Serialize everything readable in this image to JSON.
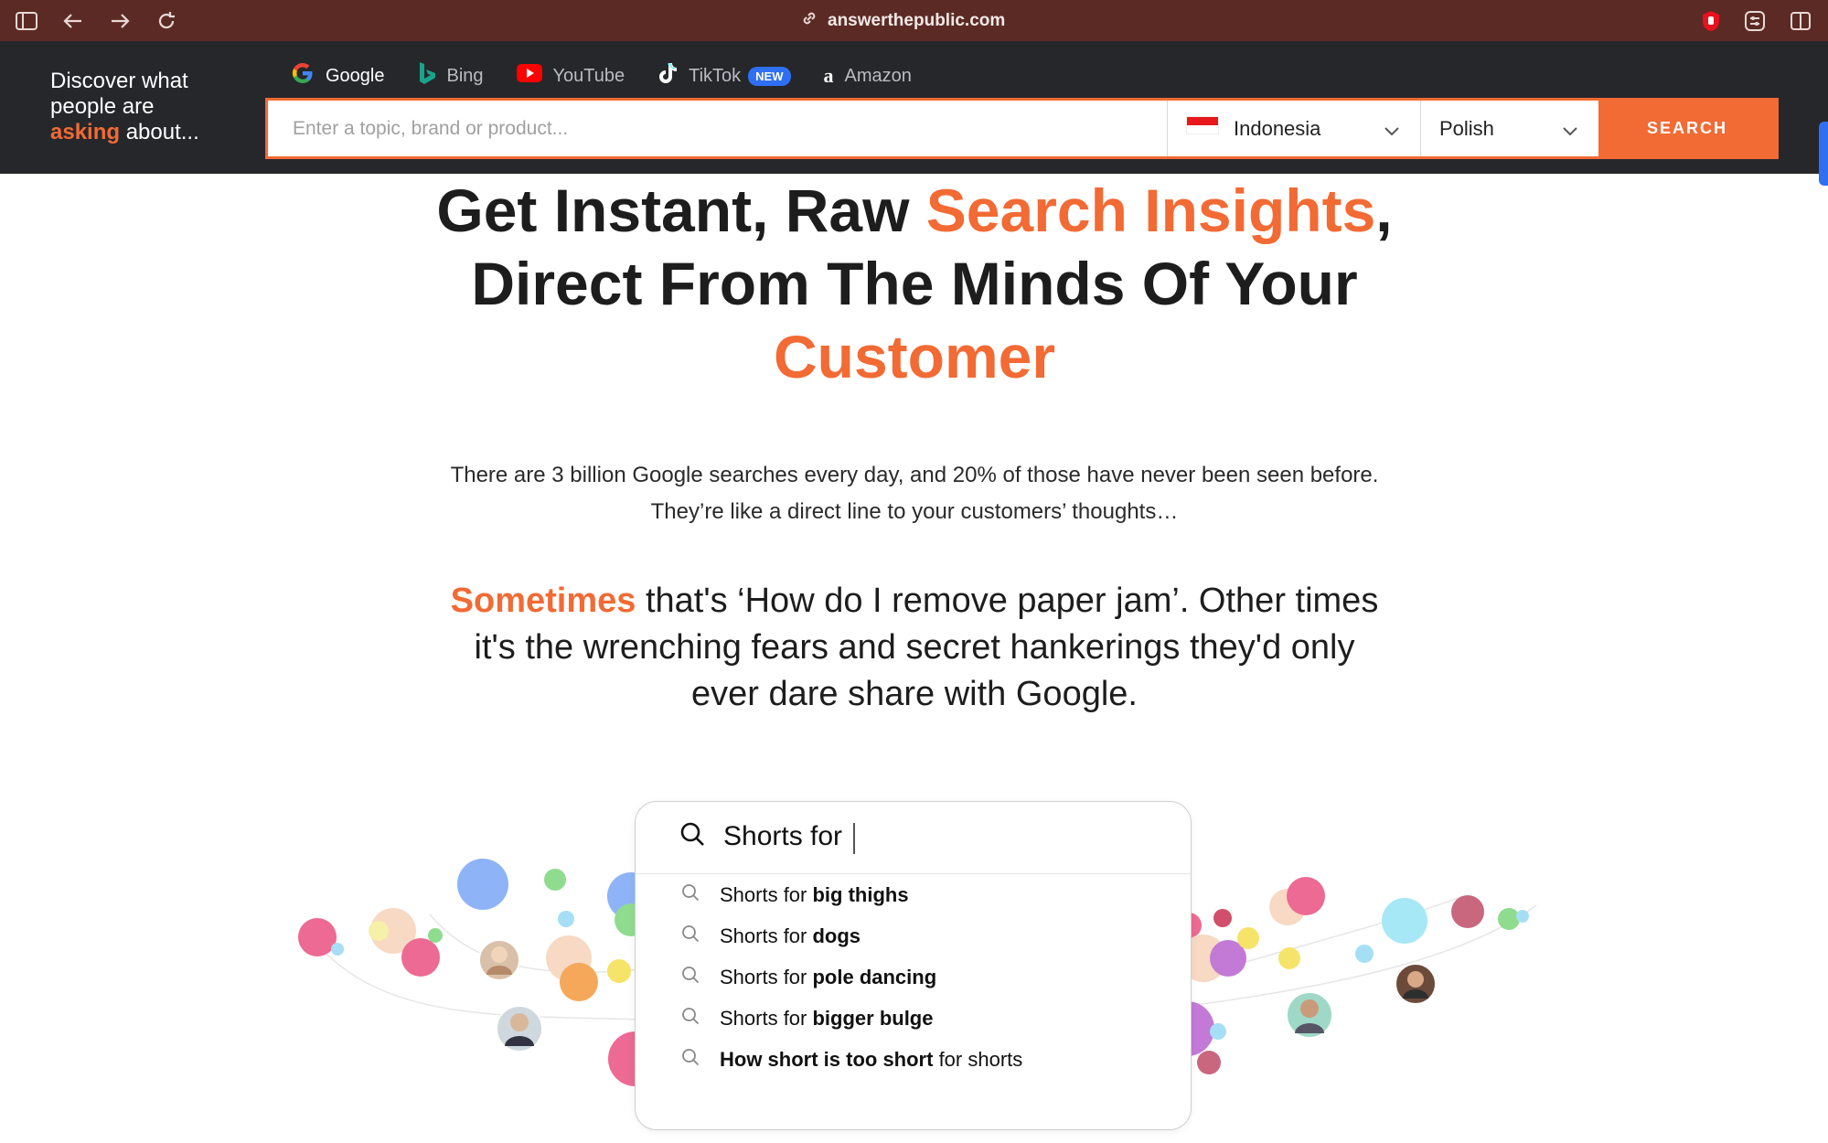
{
  "browser": {
    "url": "answerthepublic.com",
    "icons": [
      "sidebar-icon",
      "back-arrow-icon",
      "forward-arrow-icon",
      "reload-icon",
      "link-icon",
      "shield-extension-icon",
      "extension-icon",
      "split-view-icon"
    ]
  },
  "header": {
    "brand": {
      "line1": "Discover what",
      "line2": "people are",
      "highlight": "asking",
      "line3_rest": " about..."
    },
    "tabs": [
      {
        "label": "Google",
        "icon": "google-icon",
        "active": true
      },
      {
        "label": "Bing",
        "icon": "bing-icon"
      },
      {
        "label": "YouTube",
        "icon": "youtube-icon"
      },
      {
        "label": "TikTok",
        "icon": "tiktok-icon",
        "badge": "NEW"
      },
      {
        "label": "Amazon",
        "icon": "amazon-icon"
      }
    ],
    "search": {
      "placeholder": "Enter a topic, brand or product...",
      "value": "",
      "country": "Indonesia",
      "language": "Polish",
      "button": "SEARCH"
    }
  },
  "hero": {
    "headline_part1": "Get Instant, Raw ",
    "headline_highlight1": "Search Insights",
    "headline_part2": ",",
    "headline_line2": "Direct From The Minds Of Your",
    "headline_highlight2": "Customer",
    "intro_line1": "There are 3 billion Google searches every day, and 20% of those have never been seen before.",
    "intro_line2": "They’re like a direct line to your customers’ thoughts…",
    "sub_highlight": "Sometimes",
    "sub_rest_line1": " that's ‘How do I remove paper jam’. Other times",
    "sub_line2": "it's the wrenching fears and secret hankerings they'd only",
    "sub_line3": "ever dare share with Google."
  },
  "demo": {
    "query": "Shorts for",
    "suggestions": [
      {
        "prefix": "Shorts for ",
        "bold": "big thighs",
        "suffix": ""
      },
      {
        "prefix": "Shorts for ",
        "bold": "dogs",
        "suffix": ""
      },
      {
        "prefix": "Shorts for ",
        "bold": "pole dancing",
        "suffix": ""
      },
      {
        "prefix": "Shorts for ",
        "bold": "bigger bulge",
        "suffix": ""
      },
      {
        "prefix": "",
        "bold": "How short is too short",
        "suffix": " for shorts"
      }
    ]
  },
  "colors": {
    "accent": "#f26a34",
    "header_bg": "#26272b",
    "browser_bg": "#5c2a24",
    "badge": "#2f6ff2"
  }
}
